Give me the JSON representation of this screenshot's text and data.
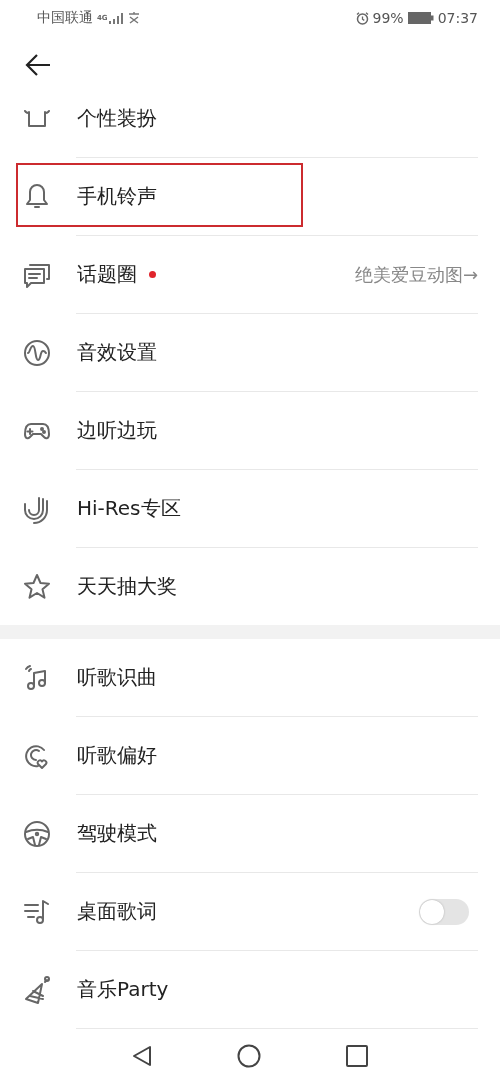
{
  "status_bar": {
    "carrier": "中国联通",
    "network": "4G",
    "battery": "99%",
    "time": "07:37"
  },
  "sections": [
    {
      "items": [
        {
          "label": "个性装扮",
          "highlighted": false
        },
        {
          "label": "手机铃声",
          "highlighted": true
        },
        {
          "label": "话题圈",
          "highlighted": false,
          "badge_dot": true,
          "detail": "绝美爱豆动图→"
        },
        {
          "label": "音效设置",
          "highlighted": false
        },
        {
          "label": "边听边玩",
          "highlighted": false
        },
        {
          "label": "Hi-Res专区",
          "highlighted": false
        },
        {
          "label": "天天抽大奖",
          "highlighted": false
        }
      ]
    },
    {
      "items": [
        {
          "label": "听歌识曲",
          "highlighted": false
        },
        {
          "label": "听歌偏好",
          "highlighted": false
        },
        {
          "label": "驾驶模式",
          "highlighted": false
        },
        {
          "label": "桌面歌词",
          "highlighted": false,
          "toggle": {
            "on": false
          }
        },
        {
          "label": "音乐Party",
          "highlighted": false
        }
      ]
    }
  ]
}
